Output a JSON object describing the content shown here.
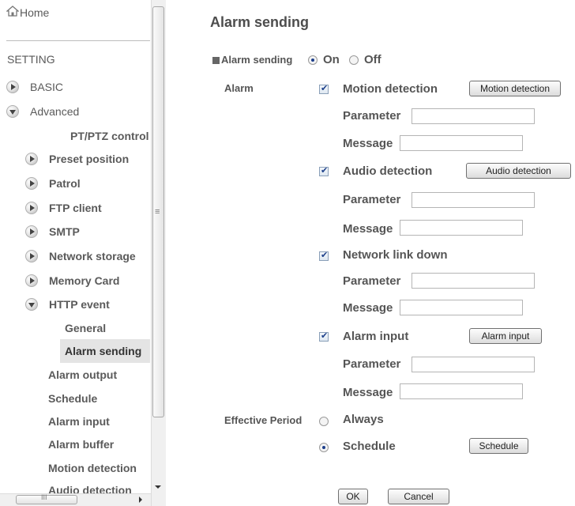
{
  "sidebar": {
    "home": "Home",
    "setting": "SETTING",
    "basic": "BASIC",
    "advanced": "Advanced",
    "ptptz": "PT/PTZ control",
    "preset": "Preset position",
    "patrol": "Patrol",
    "ftp": "FTP client",
    "smtp": "SMTP",
    "network_storage": "Network storage",
    "memory_card": "Memory Card",
    "http_event": "HTTP event",
    "general": "General",
    "alarm_sending": "Alarm sending",
    "alarm_output": "Alarm output",
    "schedule": "Schedule",
    "alarm_input": "Alarm input",
    "alarm_buffer": "Alarm buffer",
    "motion_detection": "Motion detection",
    "audio_detection": "Audio detection",
    "scroll_mid": "≡",
    "scroll_h_mid": "III"
  },
  "main": {
    "title": "Alarm sending",
    "alarm_sending_label": "Alarm sending",
    "on": "On",
    "off": "Off",
    "alarm_label": "Alarm",
    "motion": {
      "label": "Motion detection",
      "button": "Motion detection",
      "parameter": "Parameter",
      "message": "Message",
      "parameter_value": "",
      "message_value": ""
    },
    "audio": {
      "label": "Audio detection",
      "button": "Audio detection",
      "parameter": "Parameter",
      "message": "Message",
      "parameter_value": "",
      "message_value": ""
    },
    "network": {
      "label": "Network link down",
      "parameter": "Parameter",
      "message": "Message",
      "parameter_value": "",
      "message_value": ""
    },
    "alarm_input": {
      "label": "Alarm input",
      "button": "Alarm input",
      "parameter": "Parameter",
      "message": "Message",
      "parameter_value": "",
      "message_value": ""
    },
    "effective_period": "Effective Period",
    "always": "Always",
    "schedule": "Schedule",
    "schedule_button": "Schedule",
    "ok": "OK",
    "cancel": "Cancel"
  }
}
